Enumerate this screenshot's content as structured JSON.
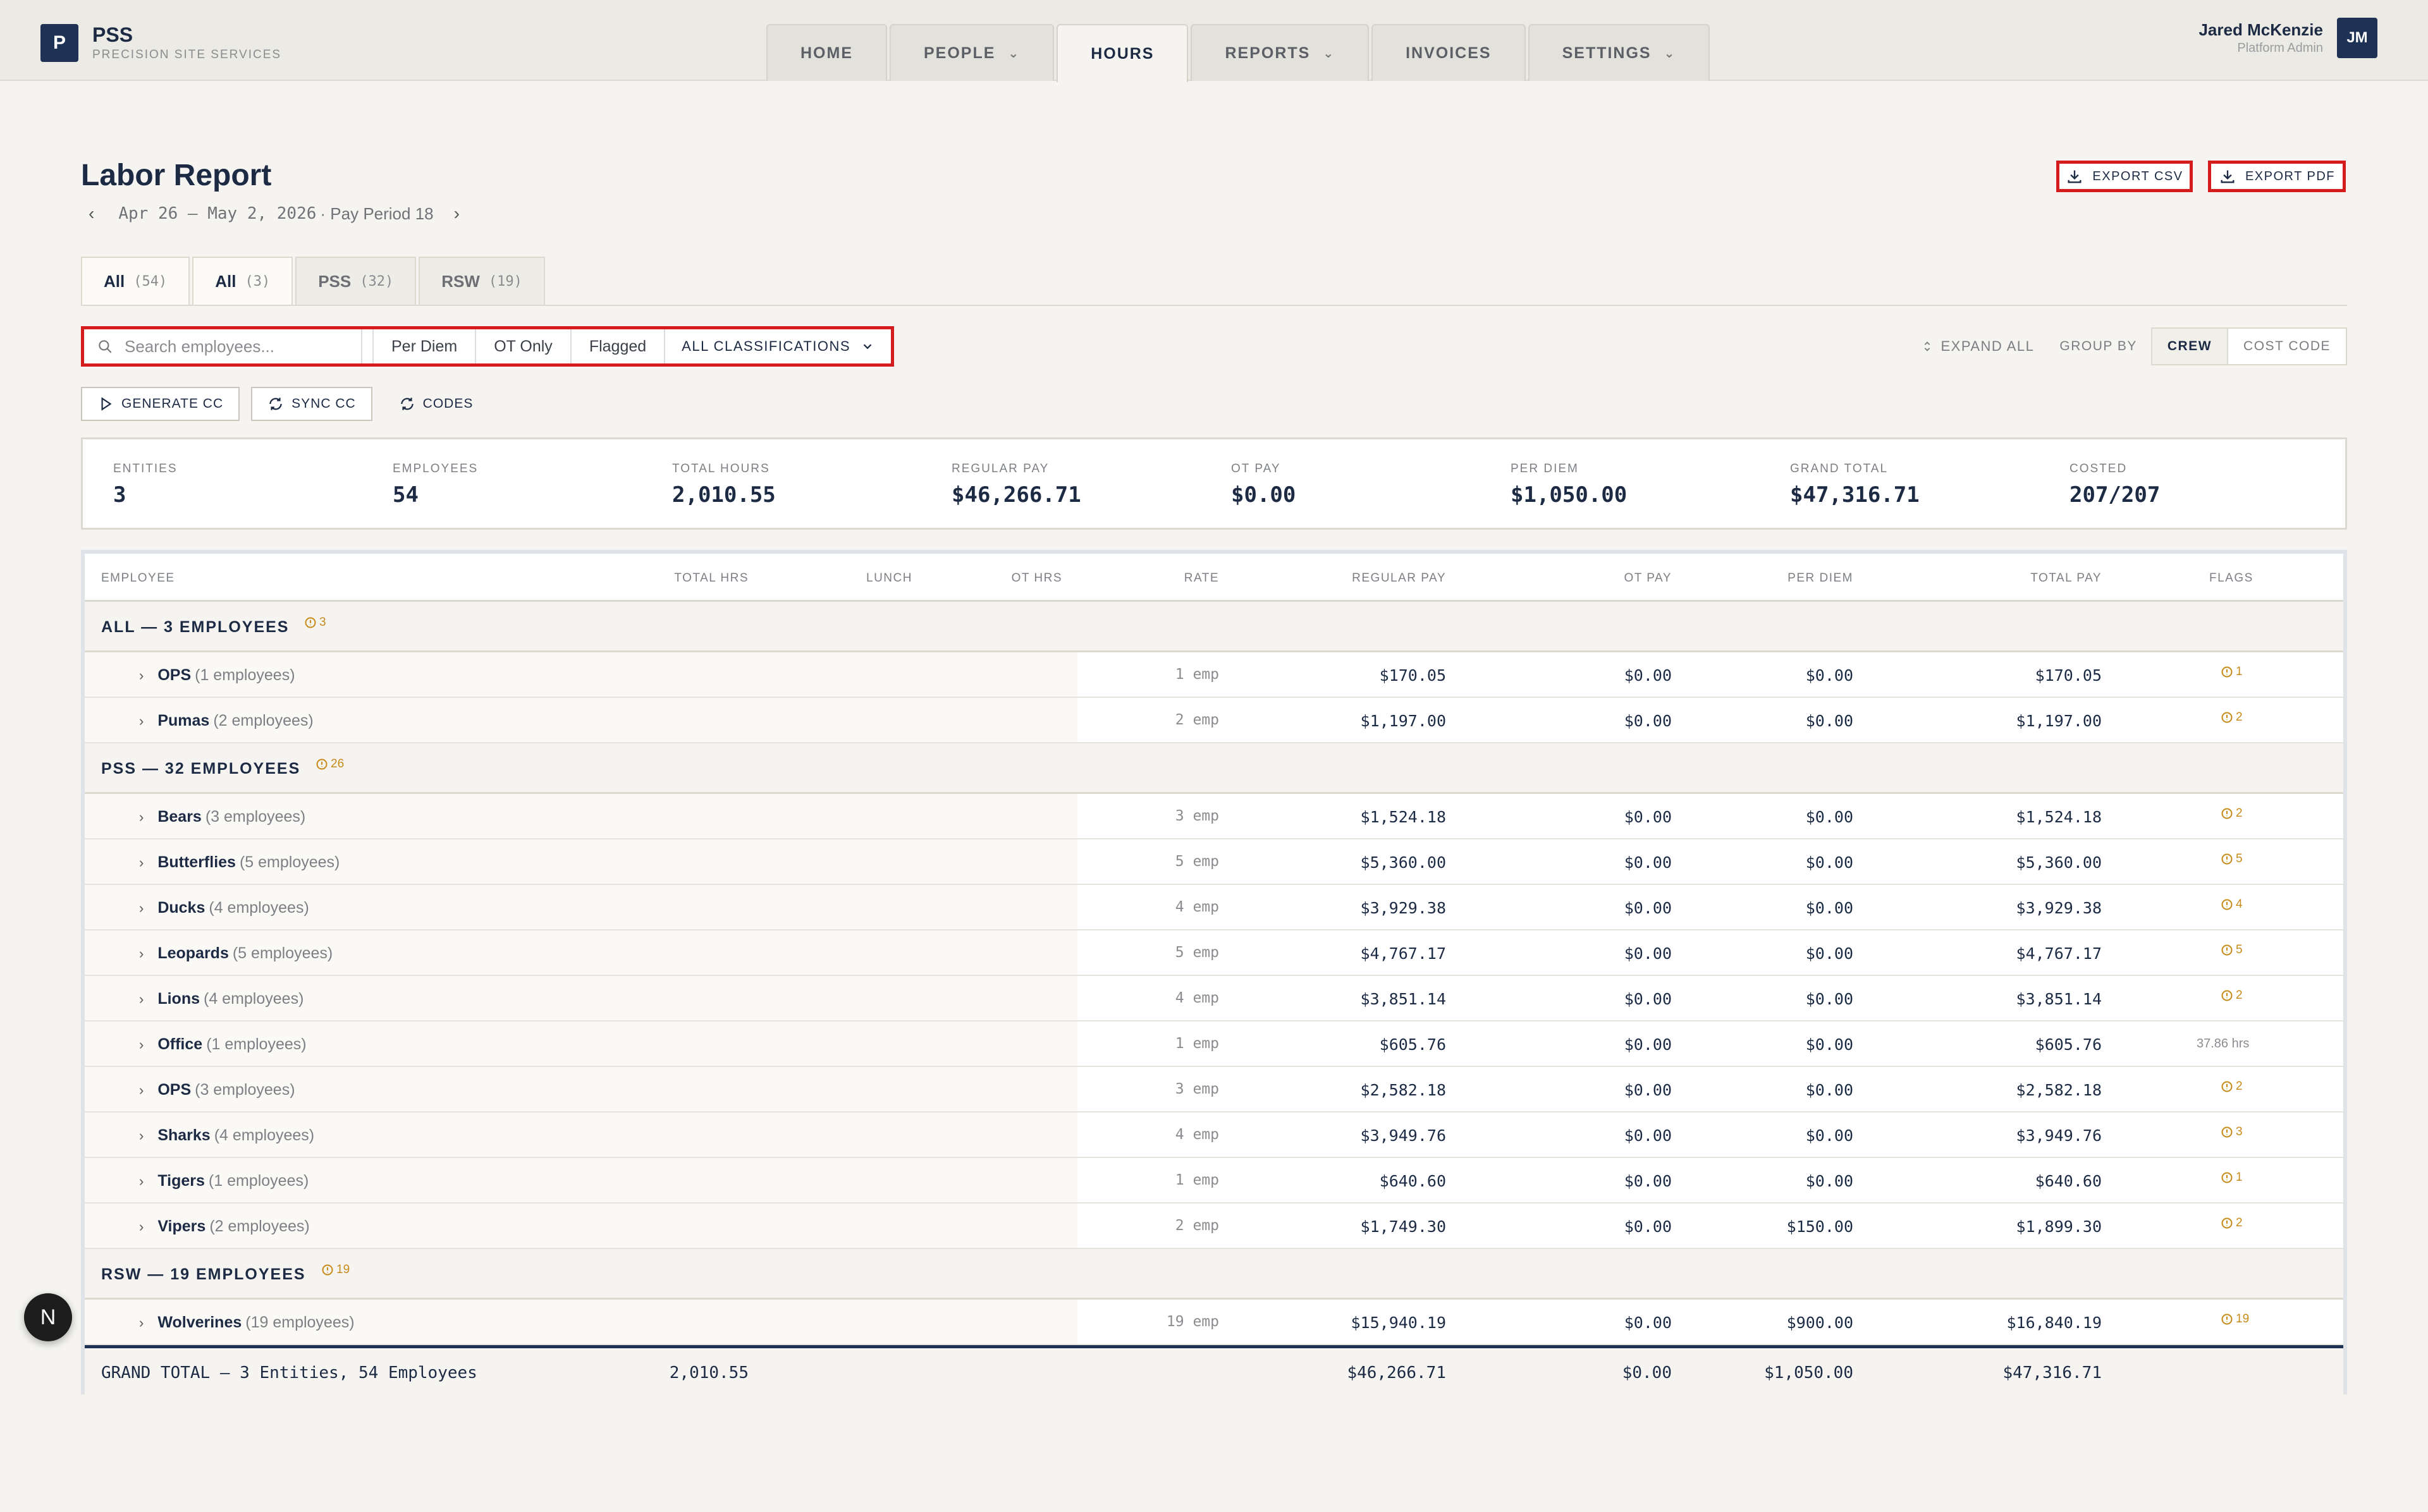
{
  "app": {
    "logo_letter": "P",
    "name": "PSS",
    "subtitle": "PRECISION SITE SERVICES"
  },
  "nav": [
    {
      "label": "HOME",
      "dropdown": false,
      "active": false
    },
    {
      "label": "PEOPLE",
      "dropdown": true,
      "active": false
    },
    {
      "label": "HOURS",
      "dropdown": false,
      "active": true
    },
    {
      "label": "REPORTS",
      "dropdown": true,
      "active": false
    },
    {
      "label": "INVOICES",
      "dropdown": false,
      "active": false
    },
    {
      "label": "SETTINGS",
      "dropdown": true,
      "active": false
    }
  ],
  "user": {
    "name": "Jared McKenzie",
    "role": "Platform Admin",
    "initials": "JM"
  },
  "page": {
    "title": "Labor Report",
    "dates": "Apr 26 – May 2, 2026",
    "pay_period": "· Pay Period 18",
    "prev": "‹",
    "next": "›"
  },
  "exports": {
    "csv": "EXPORT CSV",
    "pdf": "EXPORT PDF"
  },
  "entity_tabs": [
    {
      "label": "All",
      "count": "(54)",
      "active": true
    },
    {
      "label": "All",
      "count": "(3)",
      "active": true
    },
    {
      "label": "PSS",
      "count": "(32)",
      "active": false
    },
    {
      "label": "RSW",
      "count": "(19)",
      "active": false
    }
  ],
  "filters": {
    "search_placeholder": "Search employees...",
    "per_diem": "Per Diem",
    "ot_only": "OT Only",
    "flagged": "Flagged",
    "classification": "ALL CLASSIFICATIONS"
  },
  "tools": {
    "expand_all": "EXPAND ALL",
    "group_by": "GROUP BY",
    "crew": "CREW",
    "cost_code": "COST CODE"
  },
  "actions": {
    "generate": "GENERATE CC",
    "sync": "SYNC CC",
    "codes": "CODES"
  },
  "summary": [
    {
      "label": "ENTITIES",
      "value": "3"
    },
    {
      "label": "EMPLOYEES",
      "value": "54"
    },
    {
      "label": "TOTAL HOURS",
      "value": "2,010.55"
    },
    {
      "label": "REGULAR PAY",
      "value": "$46,266.71"
    },
    {
      "label": "OT PAY",
      "value": "$0.00"
    },
    {
      "label": "PER DIEM",
      "value": "$1,050.00"
    },
    {
      "label": "GRAND TOTAL",
      "value": "$47,316.71"
    },
    {
      "label": "COSTED",
      "value": "207/207"
    }
  ],
  "columns": [
    "EMPLOYEE",
    "TOTAL HRS",
    "LUNCH",
    "OT HRS",
    "RATE",
    "REGULAR PAY",
    "OT PAY",
    "PER DIEM",
    "TOTAL PAY",
    "FLAGS"
  ],
  "groups": [
    {
      "name": "ALL — 3 EMPLOYEES",
      "flags": "3",
      "crews": [
        {
          "name": "OPS",
          "sub": "(1 employees)",
          "rate": "1 emp",
          "regular": "$170.05",
          "ot": "$0.00",
          "per_diem": "$0.00",
          "total": "$170.05",
          "flag": "1"
        },
        {
          "name": "Pumas",
          "sub": "(2 employees)",
          "rate": "2 emp",
          "regular": "$1,197.00",
          "ot": "$0.00",
          "per_diem": "$0.00",
          "total": "$1,197.00",
          "flag": "2"
        }
      ]
    },
    {
      "name": "PSS — 32 EMPLOYEES",
      "flags": "26",
      "crews": [
        {
          "name": "Bears",
          "sub": "(3 employees)",
          "rate": "3 emp",
          "regular": "$1,524.18",
          "ot": "$0.00",
          "per_diem": "$0.00",
          "total": "$1,524.18",
          "flag": "2"
        },
        {
          "name": "Butterflies",
          "sub": "(5 employees)",
          "rate": "5 emp",
          "regular": "$5,360.00",
          "ot": "$0.00",
          "per_diem": "$0.00",
          "total": "$5,360.00",
          "flag": "5"
        },
        {
          "name": "Ducks",
          "sub": "(4 employees)",
          "rate": "4 emp",
          "regular": "$3,929.38",
          "ot": "$0.00",
          "per_diem": "$0.00",
          "total": "$3,929.38",
          "flag": "4"
        },
        {
          "name": "Leopards",
          "sub": "(5 employees)",
          "rate": "5 emp",
          "regular": "$4,767.17",
          "ot": "$0.00",
          "per_diem": "$0.00",
          "total": "$4,767.17",
          "flag": "5"
        },
        {
          "name": "Lions",
          "sub": "(4 employees)",
          "rate": "4 emp",
          "regular": "$3,851.14",
          "ot": "$0.00",
          "per_diem": "$0.00",
          "total": "$3,851.14",
          "flag": "2"
        },
        {
          "name": "Office",
          "sub": "(1 employees)",
          "rate": "1 emp",
          "regular": "$605.76",
          "ot": "$0.00",
          "per_diem": "$0.00",
          "total": "$605.76",
          "flag_text": "37.86 hrs"
        },
        {
          "name": "OPS",
          "sub": "(3 employees)",
          "rate": "3 emp",
          "regular": "$2,582.18",
          "ot": "$0.00",
          "per_diem": "$0.00",
          "total": "$2,582.18",
          "flag": "2"
        },
        {
          "name": "Sharks",
          "sub": "(4 employees)",
          "rate": "4 emp",
          "regular": "$3,949.76",
          "ot": "$0.00",
          "per_diem": "$0.00",
          "total": "$3,949.76",
          "flag": "3"
        },
        {
          "name": "Tigers",
          "sub": "(1 employees)",
          "rate": "1 emp",
          "regular": "$640.60",
          "ot": "$0.00",
          "per_diem": "$0.00",
          "total": "$640.60",
          "flag": "1"
        },
        {
          "name": "Vipers",
          "sub": "(2 employees)",
          "rate": "2 emp",
          "regular": "$1,749.30",
          "ot": "$0.00",
          "per_diem": "$150.00",
          "total": "$1,899.30",
          "flag": "2"
        }
      ]
    },
    {
      "name": "RSW — 19 EMPLOYEES",
      "flags": "19",
      "crews": [
        {
          "name": "Wolverines",
          "sub": "(19 employees)",
          "rate": "19 emp",
          "regular": "$15,940.19",
          "ot": "$0.00",
          "per_diem": "$900.00",
          "total": "$16,840.19",
          "flag": "19"
        }
      ]
    }
  ],
  "grand_total": {
    "label": "GRAND TOTAL — 3 Entities, 54 Employees",
    "hours": "2,010.55",
    "regular": "$46,266.71",
    "ot": "$0.00",
    "per_diem": "$1,050.00",
    "total": "$47,316.71"
  },
  "badge": "N",
  "colors": {
    "navy": "#1e3256",
    "highlight": "#d41c1c",
    "flag": "#c88a1a"
  }
}
